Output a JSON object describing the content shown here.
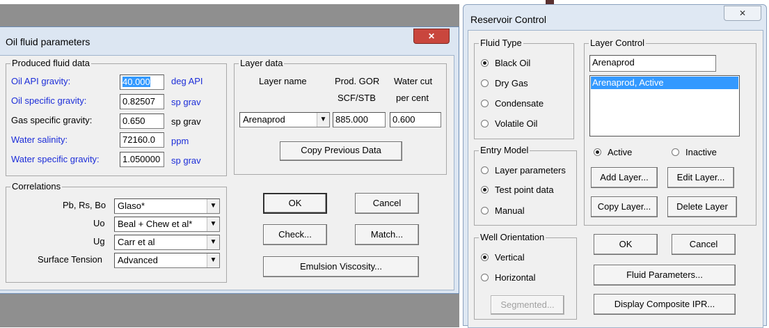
{
  "oil_dialog": {
    "title": "Oil fluid parameters",
    "close_glyph": "✕",
    "produced": {
      "group_label": "Produced fluid data",
      "rows": [
        {
          "label": "Oil API gravity:",
          "value": "40.000",
          "unit": "deg API"
        },
        {
          "label": "Oil specific gravity:",
          "value": "0.82507",
          "unit": "sp grav"
        },
        {
          "label": "Gas specific gravity:",
          "value": "0.650",
          "unit": "sp grav"
        },
        {
          "label": "Water salinity:",
          "value": "72160.0",
          "unit": "ppm"
        },
        {
          "label": "Water specific gravity:",
          "value": "1.050000",
          "unit": "sp grav"
        }
      ]
    },
    "layer": {
      "group_label": "Layer data",
      "col_layer": "Layer name",
      "col_gor": "Prod. GOR",
      "col_gor_unit": "SCF/STB",
      "col_wc": "Water cut",
      "col_wc_unit": "per cent",
      "layer_name": "Arenaprod",
      "gor": "885.000",
      "water_cut": "0.600",
      "copy_button": "Copy Previous Data"
    },
    "correlations": {
      "group_label": "Correlations",
      "rows": [
        {
          "label": "Pb, Rs, Bo",
          "value": "Glaso*"
        },
        {
          "label": "Uo",
          "value": "Beal + Chew et al*"
        },
        {
          "label": "Ug",
          "value": "Carr et al"
        },
        {
          "label": "Surface Tension",
          "value": "Advanced"
        }
      ]
    },
    "buttons": {
      "ok": "OK",
      "cancel": "Cancel",
      "check": "Check...",
      "match": "Match...",
      "emulsion": "Emulsion Viscosity..."
    }
  },
  "reservoir_dialog": {
    "title": "Reservoir Control",
    "close_glyph": "✕",
    "fluid_type": {
      "group_label": "Fluid Type",
      "options": [
        "Black Oil",
        "Dry Gas",
        "Condensate",
        "Volatile Oil"
      ],
      "selected": "Black Oil"
    },
    "entry_model": {
      "group_label": "Entry Model",
      "options": [
        "Layer parameters",
        "Test point data",
        "Manual"
      ],
      "selected": "Test point data"
    },
    "well_orientation": {
      "group_label": "Well Orientation",
      "options": [
        "Vertical",
        "Horizontal"
      ],
      "selected": "Vertical",
      "segmented_button": "Segmented..."
    },
    "layer_control": {
      "group_label": "Layer Control",
      "name_value": "Arenaprod",
      "list_items": [
        "Arenaprod, Active"
      ],
      "active": "Active",
      "inactive": "Inactive",
      "selected": "Active",
      "add": "Add Layer...",
      "edit": "Edit Layer...",
      "copy": "Copy Layer...",
      "delete": "Delete Layer"
    },
    "buttons": {
      "ok": "OK",
      "cancel": "Cancel",
      "fluid_params": "Fluid Parameters...",
      "composite": "Display Composite IPR..."
    }
  },
  "colors": {
    "desktop_gray": "#8f8f8f",
    "label_blue": "#1c2dd8",
    "selection": "#3399ff",
    "close_red": "#c9463d"
  }
}
